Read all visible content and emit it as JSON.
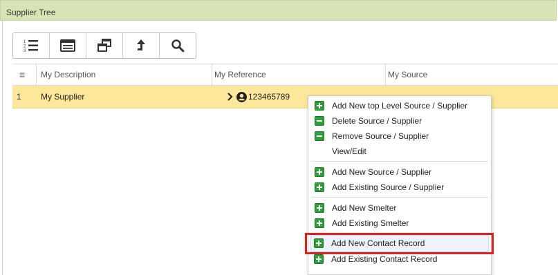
{
  "panel": {
    "title": "Supplier Tree"
  },
  "toolbar": {
    "buttons": [
      {
        "icon": "numbered-list-icon"
      },
      {
        "icon": "list-view-icon"
      },
      {
        "icon": "restore-windows-icon"
      },
      {
        "icon": "arrow-up-icon"
      },
      {
        "icon": "search-icon"
      }
    ]
  },
  "grid": {
    "menu_icon": "≡",
    "columns": [
      "My Description",
      "My Reference",
      "My Source"
    ],
    "rows": [
      {
        "index": "1",
        "description": "My Supplier",
        "reference": "123465789",
        "source": ""
      }
    ]
  },
  "context_menu": {
    "items": [
      {
        "label": "Add New top Level Source / Supplier",
        "icon": "plus-icon"
      },
      {
        "label": "Delete Source / Supplier",
        "icon": "minus-icon"
      },
      {
        "label": "Remove Source / Supplier",
        "icon": "minus-icon"
      },
      {
        "label": "View/Edit",
        "icon": ""
      },
      {
        "label": "Add New Source / Supplier",
        "icon": "plus-icon"
      },
      {
        "label": "Add Existing Source / Supplier",
        "icon": "plus-icon"
      },
      {
        "label": "Add New Smelter",
        "icon": "plus-icon"
      },
      {
        "label": "Add Existing Smelter",
        "icon": "plus-icon"
      },
      {
        "label": "Add New Contact Record",
        "icon": "plus-icon"
      },
      {
        "label": "Add Existing Contact Record",
        "icon": "plus-icon"
      }
    ],
    "highlight_color": "#e0201e"
  },
  "colors": {
    "header_bg": "#d7e5b6",
    "selected_row": "#fde79a",
    "icon_green": "#2e9e3a"
  }
}
